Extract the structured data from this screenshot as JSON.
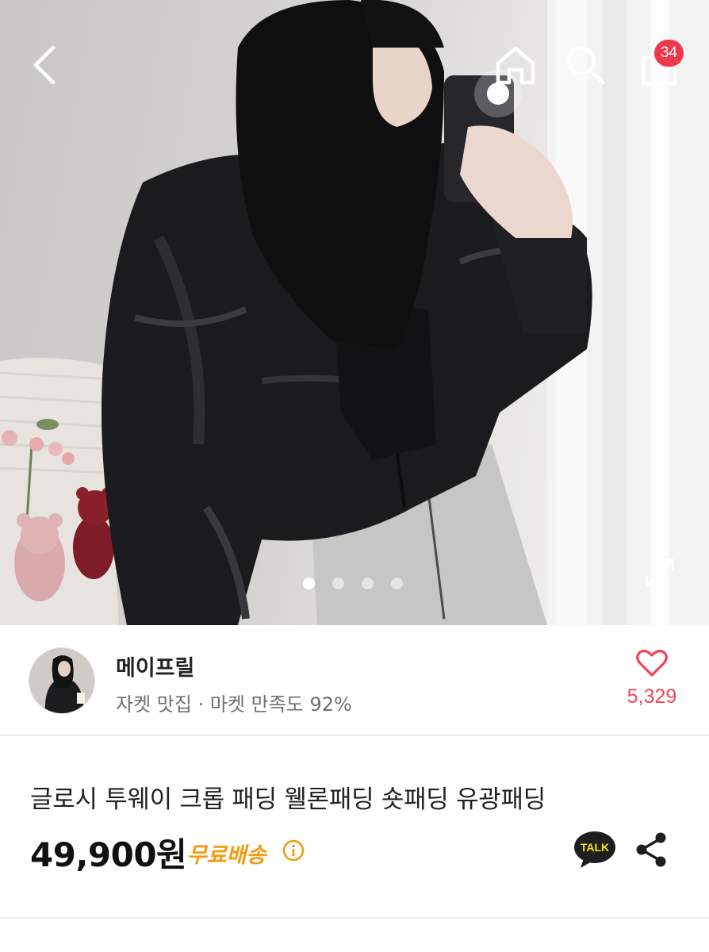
{
  "top_nav": {
    "cart_count": "34"
  },
  "gallery": {
    "image_count": 4,
    "active_index": 0
  },
  "seller": {
    "name": "메이프릴",
    "meta": "자켓 맛집 · 마켓 만족도 92%",
    "like_count": "5,329"
  },
  "product": {
    "title": "글로시 투웨이 크롭 패딩 웰론패딩 숏패딩 유광패딩",
    "price": "49,900원",
    "shipping": "무료배송",
    "talk_label": "TALK"
  },
  "colors": {
    "accent_red": "#f0384a",
    "like_red": "#f0455a",
    "shipping_orange": "#f39a12",
    "kakao_yellow": "#fee500"
  },
  "icons": [
    "back-icon",
    "home-icon",
    "search-icon",
    "cart-icon",
    "expand-icon",
    "heart-icon",
    "info-icon",
    "kakao-talk-icon",
    "share-icon"
  ]
}
